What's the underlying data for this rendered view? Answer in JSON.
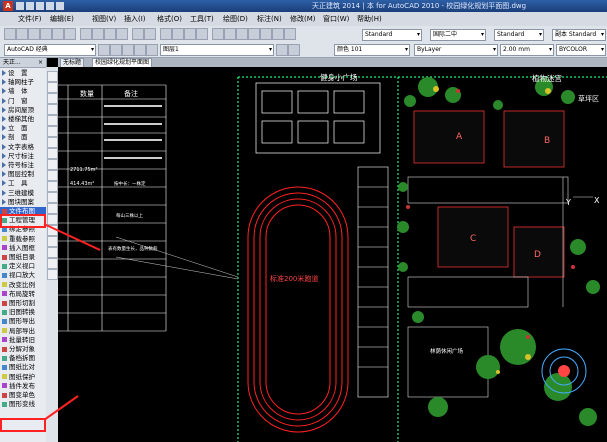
{
  "window": {
    "title": "天正建筑 2014 | 本 for AutoCAD 2010 - 校园绿化规划平面图.dwg"
  },
  "menu": [
    "文件(F)",
    "编辑(E)",
    "视图(V)",
    "插入(I)",
    "格式(O)",
    "工具(T)",
    "绘图(D)",
    "标注(N)",
    "修改(M)",
    "窗口(W)",
    "帮助(H)"
  ],
  "toolbar": {
    "workspace": "AutoCAD 经典",
    "layer": "图层1",
    "text_style": "Standard",
    "dim_style": "国际二中",
    "table_style": "Standard",
    "multileader_style": "副本 Standard",
    "color": "颜色 101",
    "linetype": "ByLayer",
    "lineweight": "2.00 mm",
    "plot_style": "BYCOLOR"
  },
  "tabs": [
    "无标题",
    "校园绿化规划平面图"
  ],
  "sidebar": {
    "title": "天正...",
    "items": [
      "设　置",
      "轴网柱子",
      "墙　体",
      "门　窗",
      "房间屋顶",
      "楼梯其他",
      "立　面",
      "剖　面",
      "文字表格",
      "尺寸标注",
      "符号标注",
      "图层控制",
      "工　具",
      "三维建模",
      "图块图案",
      "文件布图",
      "工程管理",
      "绑定参照",
      "重载参照",
      "插入图框",
      "图纸目录",
      "定义视口",
      "视口放大",
      "改变比例",
      "布局旋转",
      "图形切割",
      "旧图转换",
      "图形导出",
      "局部导出",
      "批量转旧",
      "分解对象",
      "备档拆图",
      "图纸比对",
      "图纸保护",
      "插件发布",
      "图变单色",
      "图形变线"
    ]
  },
  "drawing": {
    "table_header": [
      "数量",
      "备注"
    ],
    "table_cells": [
      "2711.75m²",
      "414.43m²",
      "按中长：一株定",
      "每山三株以上",
      "表有数量生长，品种数般"
    ],
    "labels": [
      "健身小广场",
      "植物迷宫",
      "草坪区",
      "A",
      "B",
      "C",
      "D",
      "Y",
      "X",
      "标准200米跑道",
      "林荫休闲广场"
    ]
  },
  "colors": {
    "highlight": "#ff2222",
    "selection": "#3366cc"
  }
}
